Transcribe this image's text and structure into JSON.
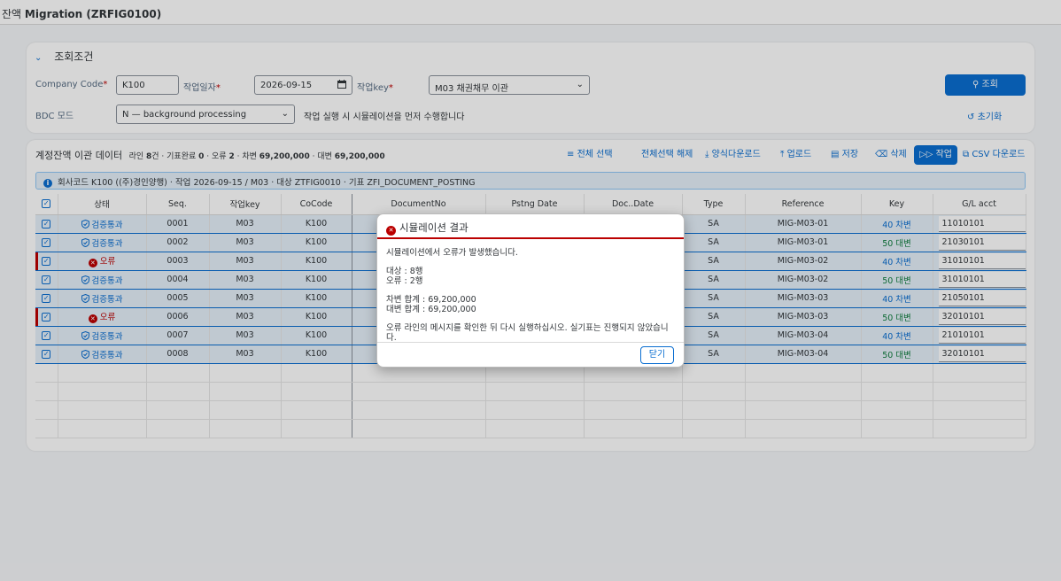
{
  "app": {
    "title_prefix": "잔액",
    "title_main": "Migration (ZRFIG0100)"
  },
  "filter": {
    "header": "조회조건",
    "company_code_label": "Company Code",
    "company_code_value": "K100",
    "work_date_label": "작업일자",
    "work_date_value": "2026-09-15",
    "work_key_label": "작업key",
    "work_key_value": "M03 채권채무 이관",
    "bdc_label": "BDC 모드",
    "bdc_value": "N — background processing",
    "note": "작업 실행 시 시뮬레이션을 먼저 수행합니다",
    "search_label": "조회",
    "reset_label": "초기화",
    "required_mark": "*"
  },
  "table": {
    "title": "계정잔액 이관 데이터",
    "meta_prefix": "라인",
    "meta_lines": "8",
    "meta_lines_unit": "건 · 기표완료",
    "meta_done": "0",
    "meta_err_label": "· 오류",
    "meta_err": "2",
    "meta_debit_label": "· 차변",
    "meta_debit": "69,200,000",
    "meta_credit_label": "· 대변",
    "meta_credit": "69,200,000",
    "toolbar": {
      "select_all": "전체 선택",
      "deselect_all": "전체선택 해제",
      "template_download": "양식다운로드",
      "upload": "업로드",
      "save": "저장",
      "delete": "삭제",
      "run": "작업",
      "csv_download": "CSV 다운로드"
    },
    "info": "회사코드 K100 ((주)경인양행) · 작업 2026-09-15 / M03 · 대상 ZTFIG0010 · 기표 ZFI_DOCUMENT_POSTING",
    "columns": [
      "상태",
      "Seq.",
      "작업key",
      "CoCode",
      "DocumentNo",
      "Pstng Date",
      "Doc..Date",
      "Type",
      "Reference",
      "Key",
      "G/L acct"
    ],
    "rows": [
      {
        "status": "검증통과",
        "ok": true,
        "seq": "0001",
        "key": "M03",
        "cocode": "K100",
        "docno": "",
        "pdate": "",
        "ddate": "",
        "type": "SA",
        "ref": "MIG-M03-01",
        "pk": "40 차변",
        "debit": true,
        "gl": "11010101"
      },
      {
        "status": "검증통과",
        "ok": true,
        "seq": "0002",
        "key": "M03",
        "cocode": "K100",
        "docno": "",
        "pdate": "",
        "ddate": "",
        "type": "SA",
        "ref": "MIG-M03-01",
        "pk": "50 대변",
        "debit": false,
        "gl": "21030101"
      },
      {
        "status": "오류",
        "ok": false,
        "seq": "0003",
        "key": "M03",
        "cocode": "K100",
        "docno": "",
        "pdate": "",
        "ddate": "",
        "type": "SA",
        "ref": "MIG-M03-02",
        "pk": "40 차변",
        "debit": true,
        "gl": "31010101"
      },
      {
        "status": "검증통과",
        "ok": true,
        "seq": "0004",
        "key": "M03",
        "cocode": "K100",
        "docno": "",
        "pdate": "",
        "ddate": "",
        "type": "SA",
        "ref": "MIG-M03-02",
        "pk": "50 대변",
        "debit": false,
        "gl": "31010101"
      },
      {
        "status": "검증통과",
        "ok": true,
        "seq": "0005",
        "key": "M03",
        "cocode": "K100",
        "docno": "",
        "pdate": "",
        "ddate": "",
        "type": "SA",
        "ref": "MIG-M03-03",
        "pk": "40 차변",
        "debit": true,
        "gl": "21050101"
      },
      {
        "status": "오류",
        "ok": false,
        "seq": "0006",
        "key": "M03",
        "cocode": "K100",
        "docno": "",
        "pdate": "",
        "ddate": "",
        "type": "SA",
        "ref": "MIG-M03-03",
        "pk": "50 대변",
        "debit": false,
        "gl": "32010101"
      },
      {
        "status": "검증통과",
        "ok": true,
        "seq": "0007",
        "key": "M03",
        "cocode": "K100",
        "docno": "",
        "pdate": "",
        "ddate": "",
        "type": "SA",
        "ref": "MIG-M03-04",
        "pk": "40 차변",
        "debit": true,
        "gl": "21010101"
      },
      {
        "status": "검증통과",
        "ok": true,
        "seq": "0008",
        "key": "M03",
        "cocode": "K100",
        "docno": "",
        "pdate": "",
        "ddate": "",
        "type": "SA",
        "ref": "MIG-M03-04",
        "pk": "50 대변",
        "debit": false,
        "gl": "32010101"
      }
    ]
  },
  "dialog": {
    "title": "시뮬레이션 결과",
    "line1": "시뮬레이션에서 오류가 발생했습니다.",
    "target": "대상 : 8행",
    "errors": "오류 : 2행",
    "debit_total": "차변 합계 : 69,200,000",
    "credit_total": "대변 합계 : 69,200,000",
    "message": "오류 라인의 메시지를 확인한 뒤 다시 실행하십시오. 실기표는 진행되지 않았습니다.",
    "close_label": "닫기"
  },
  "colors": {
    "accent": "#0a6ed1",
    "error": "#bb0000",
    "success": "#107e3e"
  },
  "icons": [
    "chevron-down-icon",
    "calendar-icon",
    "search-icon",
    "reset-icon",
    "list-select-icon",
    "download-icon",
    "upload-icon",
    "save-icon",
    "trash-icon",
    "run-icon",
    "csv-icon",
    "info-icon",
    "shield-check-icon",
    "error-icon",
    "checkbox-icon"
  ]
}
